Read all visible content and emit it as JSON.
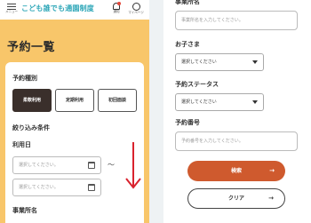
{
  "header": {
    "menu_label": "メニュー",
    "logo_text": "こども誰でも通園制度",
    "notification_label": "通知",
    "mypage_label": "マイページ"
  },
  "page": {
    "title": "予約一覧"
  },
  "filter": {
    "reservation_type_label": "予約種別",
    "types": [
      "柔軟利用",
      "定期利用",
      "初回面談"
    ],
    "active_type": "柔軟利用",
    "conditions_label": "絞り込み条件",
    "date_label": "利用日",
    "date_from_placeholder": "選択してください。",
    "date_to_placeholder": "選択してください。",
    "range_separator": "〜",
    "facility_label": "事業所名",
    "facility_placeholder": "事業所名を入力してください。",
    "child_label": "お子さま",
    "child_select": "選択してください",
    "status_label": "予約ステータス",
    "status_select": "選択してください",
    "number_label": "予約番号",
    "number_placeholder": "予約番号を入力してください。"
  },
  "actions": {
    "search_label": "検索",
    "clear_label": "クリア"
  },
  "colors": {
    "header_bg": "#f8c66a",
    "accent": "#cf5a2e",
    "logo": "#2fa7b8",
    "active_tab": "#3a2f2b",
    "scroll_arrow": "#d9232e"
  }
}
